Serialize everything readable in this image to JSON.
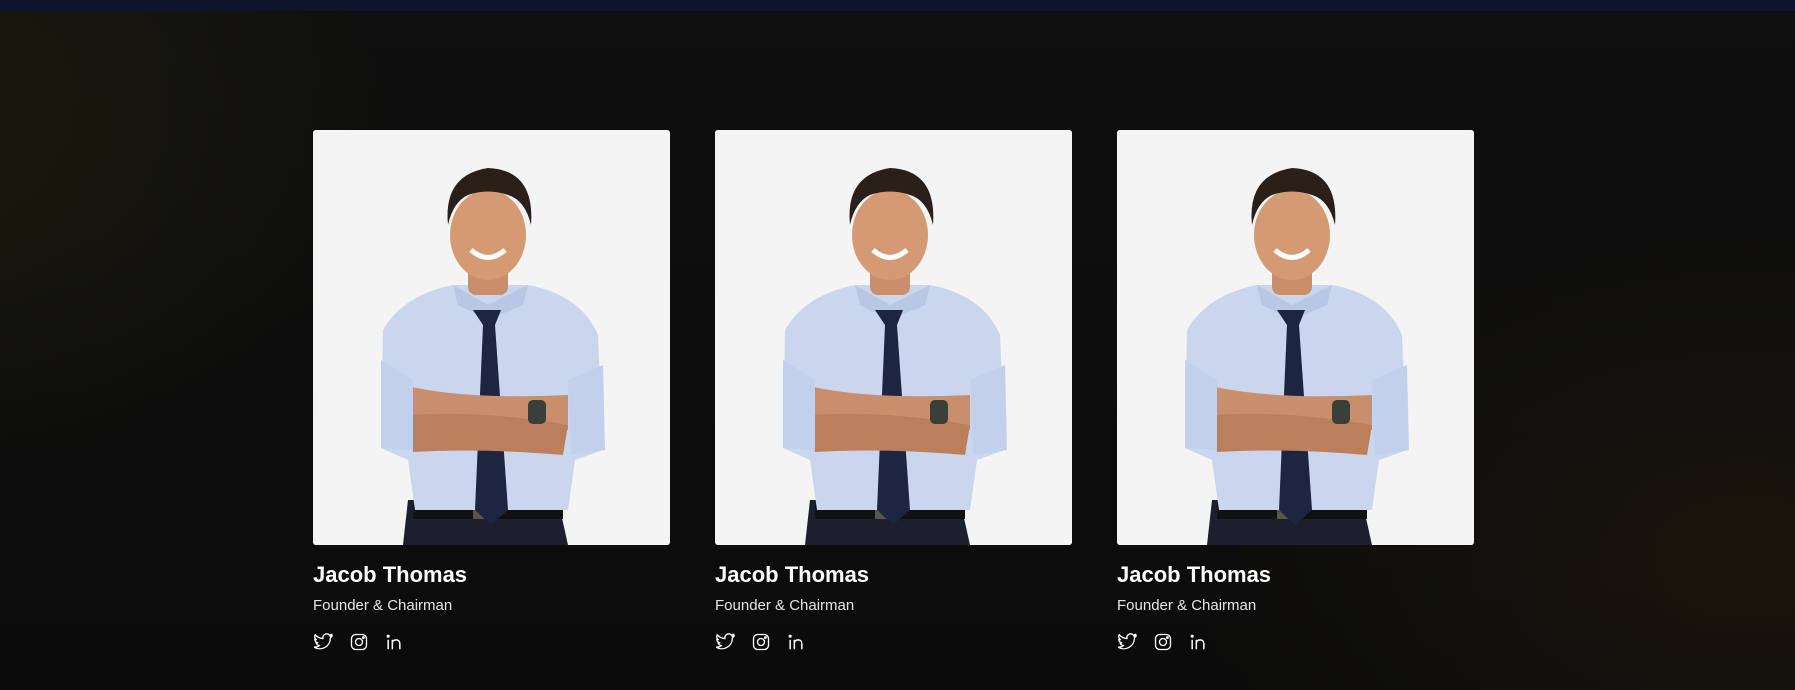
{
  "team": {
    "members": [
      {
        "name": "Jacob Thomas",
        "role": "Founder & Chairman",
        "photo": "man-crossed-arms-photo",
        "socials": [
          "twitter-icon",
          "instagram-icon",
          "linkedin-icon"
        ]
      },
      {
        "name": "Jacob Thomas",
        "role": "Founder & Chairman",
        "photo": "man-crossed-arms-photo",
        "socials": [
          "twitter-icon",
          "instagram-icon",
          "linkedin-icon"
        ]
      },
      {
        "name": "Jacob Thomas",
        "role": "Founder & Chairman",
        "photo": "man-crossed-arms-photo",
        "socials": [
          "twitter-icon",
          "instagram-icon",
          "linkedin-icon"
        ]
      }
    ]
  },
  "colors": {
    "background": "#0c0c0c",
    "top_bar": "#10142a",
    "photo_background": "#f4f4f4",
    "text": "#ffffff"
  }
}
